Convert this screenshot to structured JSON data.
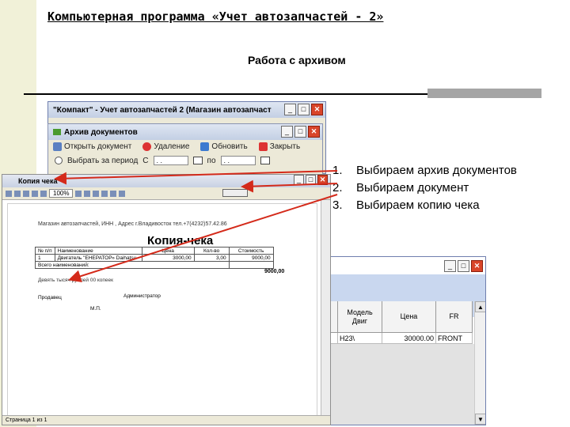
{
  "slide": {
    "title": "Компьютерная программа «Учет автозапчастей - 2»",
    "subtitle": "Работа с архивом"
  },
  "main_window": {
    "title": "\"Компакт\" - Учет автозапчастей 2 (Магазин автозапчаст"
  },
  "archive_window": {
    "title": "Архив документов",
    "toolbar": {
      "open": "Открыть документ",
      "delete": "Удаление",
      "refresh": "Обновить",
      "close": "Закрыть"
    },
    "filter": {
      "label": "Выбрать за период",
      "from_prefix": "С",
      "from_value": "  . .",
      "to_prefix": "по",
      "to_value": "  . ."
    }
  },
  "preview_window": {
    "title": "Копия чека",
    "zoom": "100%",
    "status": "Страница 1 из 1",
    "doc": {
      "header": "Магазин автозапчастей, ИНН , Адрес г.Владивосток тел.+7(4232)57.42.86",
      "title": "Копия-чека",
      "columns": [
        "№ п/п",
        "Наименование",
        "Цена",
        "Кол-во",
        "Стоимость"
      ],
      "row": [
        "1",
        "Двигатель \"ЕНЕРАТОР» Daihatsu",
        "3000,00",
        "3,00",
        "9000,00"
      ],
      "total_label": "Всего наименований:",
      "total_value": "9000,00",
      "amount_words": "Девять тысяч рублей 00 копеек",
      "sign_label": "Продавец",
      "role": "Администратор",
      "stamp": "М.П."
    }
  },
  "bottom_window": {
    "columns": [
      "Модель Двиг",
      "Цена",
      "FR"
    ],
    "row": [
      "H23\\",
      "30000.00",
      "FRONT"
    ]
  },
  "steps": [
    {
      "num": "1.",
      "text": "Выбираем архив документов"
    },
    {
      "num": "2.",
      "text": "Выбираем документ"
    },
    {
      "num": "3.",
      "text": "Выбираем копию чека"
    }
  ],
  "colors": {
    "arrow": "#d42a1a",
    "left_strip": "#f1f1d8",
    "title_bar": "#c3cfe4"
  }
}
